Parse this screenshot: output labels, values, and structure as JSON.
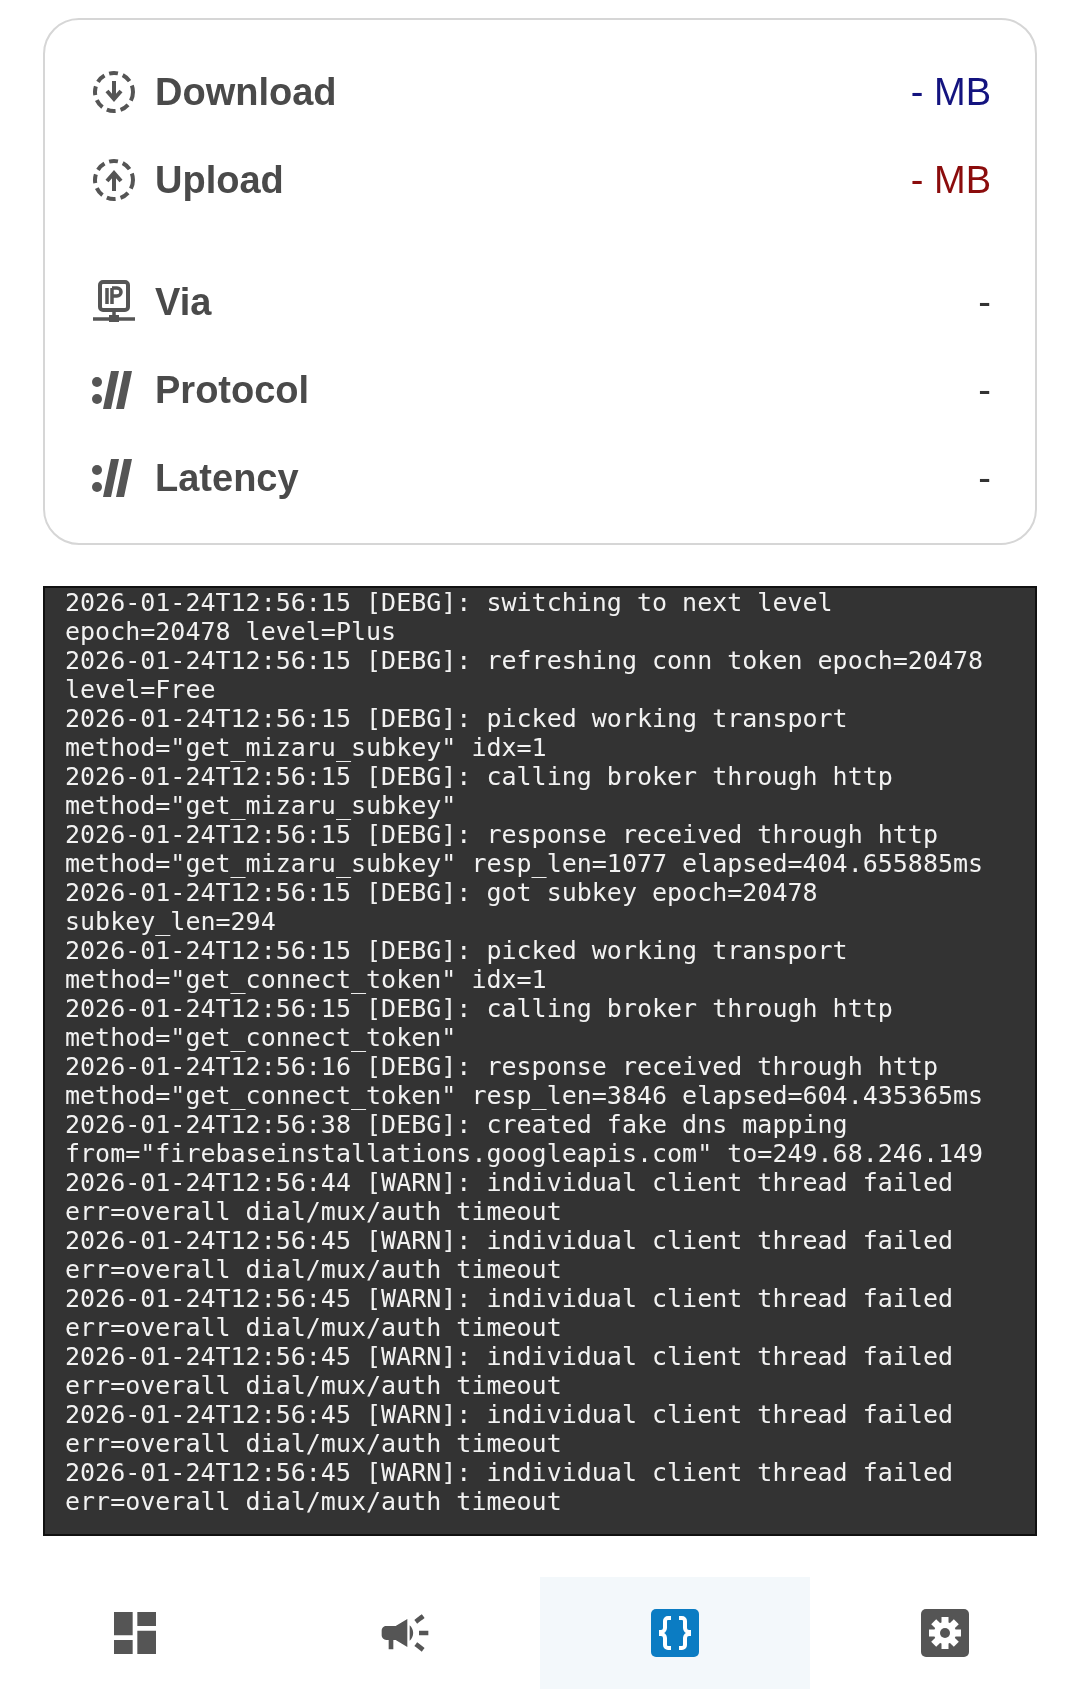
{
  "transfer": [
    {
      "kind": "download",
      "label": "Download",
      "value": "- MB",
      "color": "#13137f"
    },
    {
      "kind": "upload",
      "label": "Upload",
      "value": "- MB",
      "color": "#8b0c0c"
    }
  ],
  "connection": [
    {
      "kind": "ip",
      "label": "Via",
      "value": "-"
    },
    {
      "kind": "speed",
      "label": "Protocol",
      "value": "-"
    },
    {
      "kind": "speed",
      "label": "Latency",
      "value": "-"
    }
  ],
  "log": {
    "lines": [
      "2026-01-24T12:56:15 [DEBG]: switching to next level",
      "epoch=20478 level=Plus",
      "2026-01-24T12:56:15 [DEBG]: refreshing conn token epoch=20478",
      "level=Free",
      "2026-01-24T12:56:15 [DEBG]: picked working transport",
      "method=\"get_mizaru_subkey\" idx=1",
      "2026-01-24T12:56:15 [DEBG]: calling broker through http",
      "method=\"get_mizaru_subkey\"",
      "2026-01-24T12:56:15 [DEBG]: response received through http",
      "method=\"get_mizaru_subkey\" resp_len=1077 elapsed=404.655885ms",
      "2026-01-24T12:56:15 [DEBG]: got subkey epoch=20478",
      "subkey_len=294",
      "2026-01-24T12:56:15 [DEBG]: picked working transport",
      "method=\"get_connect_token\" idx=1",
      "2026-01-24T12:56:15 [DEBG]: calling broker through http",
      "method=\"get_connect_token\"",
      "2026-01-24T12:56:16 [DEBG]: response received through http",
      "method=\"get_connect_token\" resp_len=3846 elapsed=604.435365ms",
      "2026-01-24T12:56:38 [DEBG]: created fake dns mapping",
      "from=\"firebaseinstallations.googleapis.com\" to=249.68.246.149",
      "2026-01-24T12:56:44 [WARN]: individual client thread failed",
      "err=overall dial/mux/auth timeout",
      "2026-01-24T12:56:45 [WARN]: individual client thread failed",
      "err=overall dial/mux/auth timeout",
      "2026-01-24T12:56:45 [WARN]: individual client thread failed",
      "err=overall dial/mux/auth timeout",
      "2026-01-24T12:56:45 [WARN]: individual client thread failed",
      "err=overall dial/mux/auth timeout",
      "2026-01-24T12:56:45 [WARN]: individual client thread failed",
      "err=overall dial/mux/auth timeout",
      "2026-01-24T12:56:45 [WARN]: individual client thread failed",
      "err=overall dial/mux/auth timeout"
    ]
  },
  "nav": [
    {
      "kind": "dashboard",
      "selected": false
    },
    {
      "kind": "announcements",
      "selected": false
    },
    {
      "kind": "logs",
      "selected": true
    },
    {
      "kind": "settings",
      "selected": false
    }
  ]
}
